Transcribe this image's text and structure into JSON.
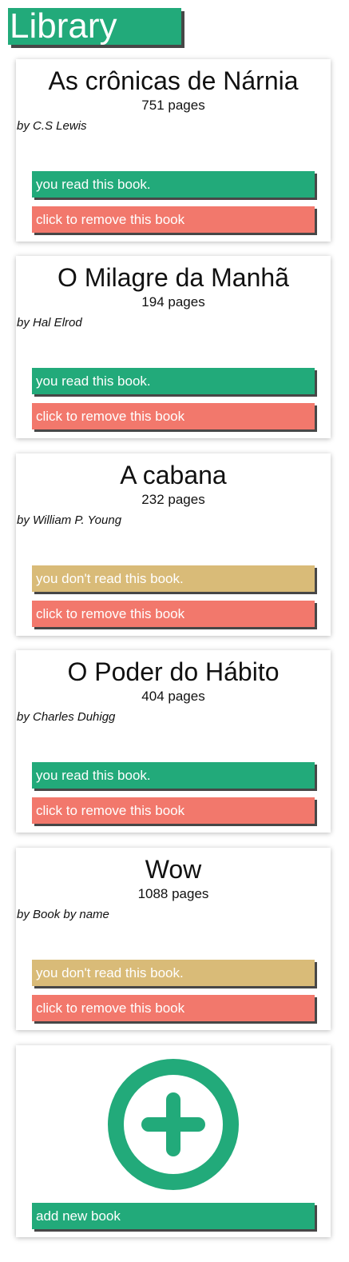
{
  "header": {
    "title": "Library"
  },
  "books": [
    {
      "title": "As crônicas de Nárnia",
      "pages": "751 pages",
      "author": "by C.S Lewis",
      "status": "you read this book.",
      "read": true,
      "remove": "click to remove this book"
    },
    {
      "title": "O Milagre da Manhã",
      "pages": "194 pages",
      "author": "by Hal Elrod",
      "status": "you read this book.",
      "read": true,
      "remove": "click to remove this book"
    },
    {
      "title": "A cabana",
      "pages": "232 pages",
      "author": "by William P. Young",
      "status": "you don't read this book.",
      "read": false,
      "remove": "click to remove this book"
    },
    {
      "title": "O Poder do Hábito",
      "pages": "404 pages",
      "author": "by Charles Duhigg",
      "status": "you read this book.",
      "read": true,
      "remove": "click to remove this book"
    },
    {
      "title": "Wow",
      "pages": "1088 pages",
      "author": "by Book by name",
      "status": "you don't read this book.",
      "read": false,
      "remove": "click to remove this book"
    }
  ],
  "add": {
    "label": "add new book",
    "icon": "plus-circle-icon"
  },
  "colors": {
    "accent": "#22aa7a",
    "unread": "#d9bb78",
    "remove": "#f2786c",
    "shadow": "#474747"
  }
}
